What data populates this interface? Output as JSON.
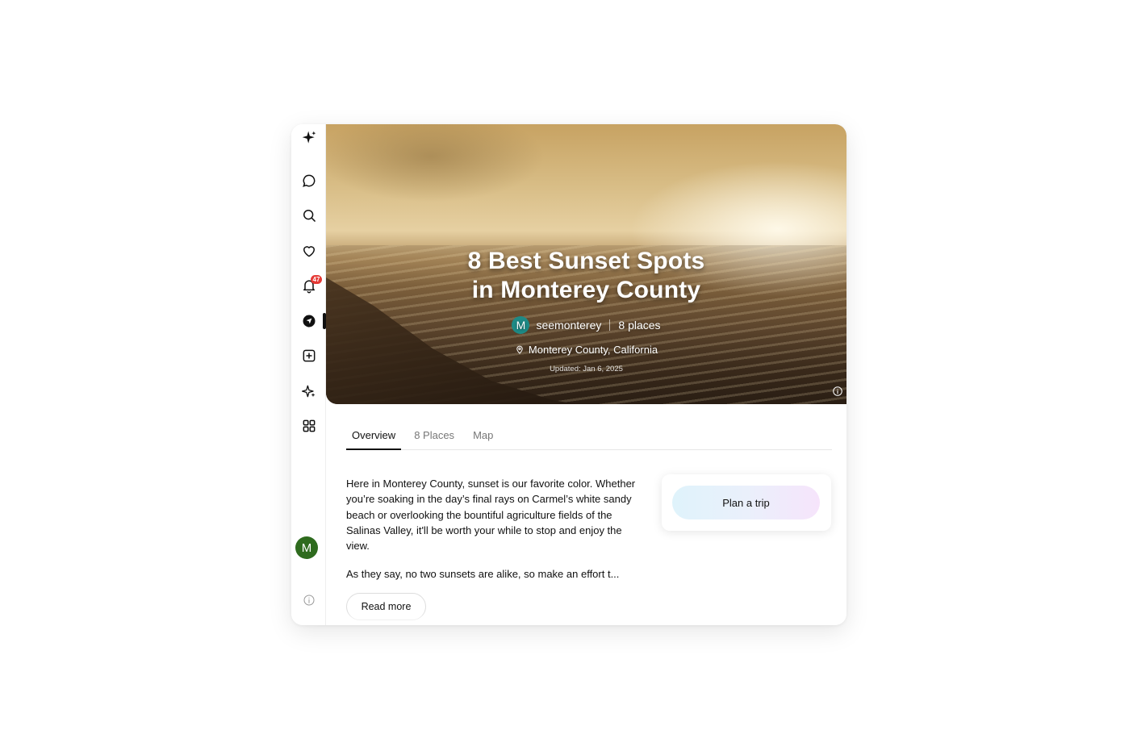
{
  "sidebar": {
    "items": [
      {
        "name": "sparkle-logo-icon"
      },
      {
        "name": "chat-icon"
      },
      {
        "name": "search-icon"
      },
      {
        "name": "heart-icon"
      },
      {
        "name": "bell-icon",
        "badge": "47"
      },
      {
        "name": "navigate-icon"
      },
      {
        "name": "add-square-icon"
      },
      {
        "name": "sparkles-icon"
      },
      {
        "name": "grid-icon"
      }
    ],
    "avatar_initial": "M",
    "avatar_color": "#2e6b1e"
  },
  "hero": {
    "title": "8 Best Sunset Spots\nin Monterey County",
    "author_initial": "M",
    "author": "seemonterey",
    "places": "8 places",
    "location": "Monterey County, California",
    "updated": "Updated: Jan 6, 2025"
  },
  "tabs": [
    {
      "label": "Overview",
      "active": true
    },
    {
      "label": "8 Places",
      "active": false
    },
    {
      "label": "Map",
      "active": false
    }
  ],
  "overview": {
    "paragraph1": "Here in Monterey County, sunset is our favorite color. Whether you’re soaking in the day’s final rays on Carmel’s white sandy beach or overlooking the bountiful agriculture fields of the Salinas Valley, it'll be worth your while to stop and enjoy the view.",
    "paragraph2": "As they say, no two sunsets are alike, so make an effort t...",
    "read_more": "Read more"
  },
  "plan": {
    "button": "Plan a trip"
  }
}
